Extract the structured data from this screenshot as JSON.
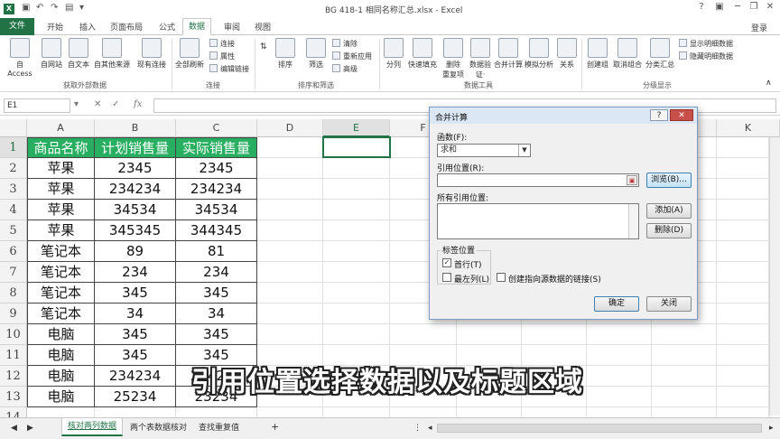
{
  "titlebar": {
    "title": "BG 418-1 相同名称汇总.xlsx - Excel",
    "help": "?",
    "minimize": "─",
    "restore": "❐",
    "close": "✕"
  },
  "ribbon_tabs": {
    "file": "文件",
    "items": [
      "开始",
      "插入",
      "页面布局",
      "公式",
      "数据",
      "审阅",
      "视图"
    ],
    "active": "数据",
    "login": "登录"
  },
  "ribbon": {
    "get_external": {
      "buttons": [
        "自 Access",
        "自网站",
        "自文本",
        "自其他来源",
        "现有连接"
      ],
      "label": "获取外部数据"
    },
    "connections": {
      "refresh": "全部刷新",
      "small": [
        "连接",
        "属性",
        "编辑链接"
      ],
      "label": "连接"
    },
    "sort_filter": {
      "sort": "排序",
      "filter": "筛选",
      "small": [
        "清除",
        "重新应用",
        "高级"
      ],
      "label": "排序和筛选"
    },
    "data_tools": {
      "buttons": [
        "分列",
        "快速填充",
        "删除\n重复项",
        "数据验\n证·",
        "合并计算",
        "模拟分析",
        "关系"
      ],
      "label": "数据工具"
    },
    "outline": {
      "buttons": [
        "创建组",
        "取消组合",
        "分类汇总"
      ],
      "small": [
        "显示明细数据",
        "隐藏明细数据"
      ],
      "label": "分级显示"
    }
  },
  "formula_bar": {
    "name_box": "E1",
    "cancel": "✕",
    "enter": "✓",
    "fx": "fx",
    "value": ""
  },
  "grid": {
    "columns": [
      "A",
      "B",
      "C",
      "D",
      "E",
      "F",
      "K"
    ],
    "rows": [
      "1",
      "2",
      "3",
      "4",
      "5",
      "6",
      "7",
      "8",
      "9",
      "10",
      "11",
      "12",
      "13",
      "14"
    ],
    "table": {
      "headers": [
        "商品名称",
        "计划销售量",
        "实际销售量"
      ],
      "rows": [
        [
          "苹果",
          "2345",
          "2345"
        ],
        [
          "苹果",
          "234234",
          "234234"
        ],
        [
          "苹果",
          "34534",
          "34534"
        ],
        [
          "苹果",
          "345345",
          "344345"
        ],
        [
          "笔记本",
          "89",
          "81"
        ],
        [
          "笔记本",
          "234",
          "234"
        ],
        [
          "笔记本",
          "345",
          "345"
        ],
        [
          "笔记本",
          "34",
          "34"
        ],
        [
          "电脑",
          "345",
          "345"
        ],
        [
          "电脑",
          "345",
          "345"
        ],
        [
          "电脑",
          "234234",
          "234234"
        ],
        [
          "电脑",
          "25234",
          "23234"
        ]
      ]
    },
    "colors": {
      "header_bg": "#27ae60",
      "accent": "#217346"
    }
  },
  "sheets": {
    "tabs": [
      "核对两列数据",
      "两个表数据核对",
      "查找重复值"
    ],
    "active": "核对两列数据",
    "add": "+"
  },
  "dialog": {
    "title": "合并计算",
    "help": "?",
    "close": "✕",
    "function_label": "函数(F):",
    "function_value": "求和",
    "reference_label": "引用位置(R):",
    "browse": "浏览(B)...",
    "all_refs_label": "所有引用位置:",
    "add": "添加(A)",
    "delete": "删除(D)",
    "label_position": "标签位置",
    "first_row": "首行(T)",
    "first_row_checked": true,
    "left_column": "最左列(L)",
    "create_links": "创建指向源数据的链接(S)",
    "ok": "确定",
    "close_button": "关闭"
  },
  "subtitle": "引用位置选择数据以及标题区域"
}
